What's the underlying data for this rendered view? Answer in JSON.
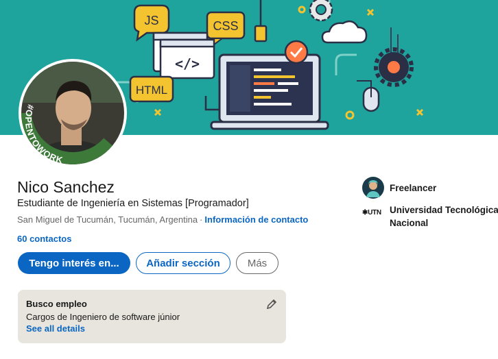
{
  "profile": {
    "name": "Nico Sanchez",
    "headline": "Estudiante de Ingeniería en Sistemas [Programador]",
    "location": "San Miguel de Tucumán, Tucumán, Argentina",
    "separator": "·",
    "contact_link": "Información de contacto",
    "connections": "60 contactos",
    "open_to_work_frame": "#OPENTOWORK"
  },
  "banner": {
    "badges": [
      "JS",
      "CSS",
      "HTML"
    ],
    "code_symbol": "</>"
  },
  "actions": {
    "primary": "Tengo interés en...",
    "secondary": "Añadir sección",
    "more": "Más"
  },
  "sidebar": {
    "company": "Freelancer",
    "university": "Universidad Tecnológica Nacional",
    "university_logo": "UTN"
  },
  "open_to_work": {
    "title": "Busco empleo",
    "description": "Cargos de Ingeniero de software júnior",
    "link": "See all details"
  },
  "colors": {
    "banner": "#1fa39d",
    "brand_blue": "#0a66c2",
    "otw_green": "#3d7a3a",
    "box_bg": "#e8e5de"
  },
  "icons": [
    "pencil-icon",
    "freelancer-avatar-icon",
    "utn-logo",
    "laptop-icon",
    "cloud-icon",
    "gear-icon",
    "mouse-icon",
    "check-icon"
  ]
}
